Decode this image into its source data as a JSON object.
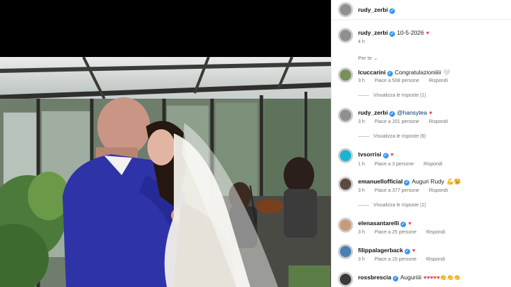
{
  "header": {
    "username": "rudy_zerbi"
  },
  "caption": {
    "username": "rudy_zerbi",
    "text": "10-5-2026",
    "time": "4 h"
  },
  "sort_label": "Per te",
  "comments": [
    {
      "username": "lcuccarini",
      "text": "Congratulazioniiiii",
      "emoji": "🤍",
      "time": "3 h",
      "likes": "Piace a 508 persone",
      "reply": "Rispondi",
      "view_replies": "Visualizza le risposte (1)"
    },
    {
      "username": "rudy_zerbi",
      "text": "@hansytea",
      "emoji": "♥",
      "time": "3 h",
      "likes": "Piace a 201 persone",
      "reply": "Rispondi",
      "view_replies": "Visualizza le risposte (6)"
    },
    {
      "username": "tvsorrisi",
      "text": "",
      "emoji": "♥",
      "time": "1 h",
      "likes": "Piace a 3 persone",
      "reply": "Rispondi"
    },
    {
      "username": "emanuellofficial",
      "text": "Auguri Rudy",
      "emoji": "💪😉",
      "time": "3 h",
      "likes": "Piace a 377 persone",
      "reply": "Rispondi",
      "view_replies": "Visualizza le risposte (1)"
    },
    {
      "username": "elenasantarelli",
      "text": "",
      "emoji": "♥",
      "time": "3 h",
      "likes": "Piace a 25 persone",
      "reply": "Rispondi"
    },
    {
      "username": "filippalagerback",
      "text": "",
      "emoji": "♥",
      "time": "3 h",
      "likes": "Piace a 15 persone",
      "reply": "Rispondi"
    },
    {
      "username": "rossbrescia",
      "text": "Auguriiii",
      "emoji": "♥♥♥♥♥👏👏👏",
      "time": "",
      "likes": "",
      "reply": ""
    }
  ],
  "colors": {
    "verified": "#3897f0",
    "heart": "#ed4956",
    "muted": "#737373"
  }
}
